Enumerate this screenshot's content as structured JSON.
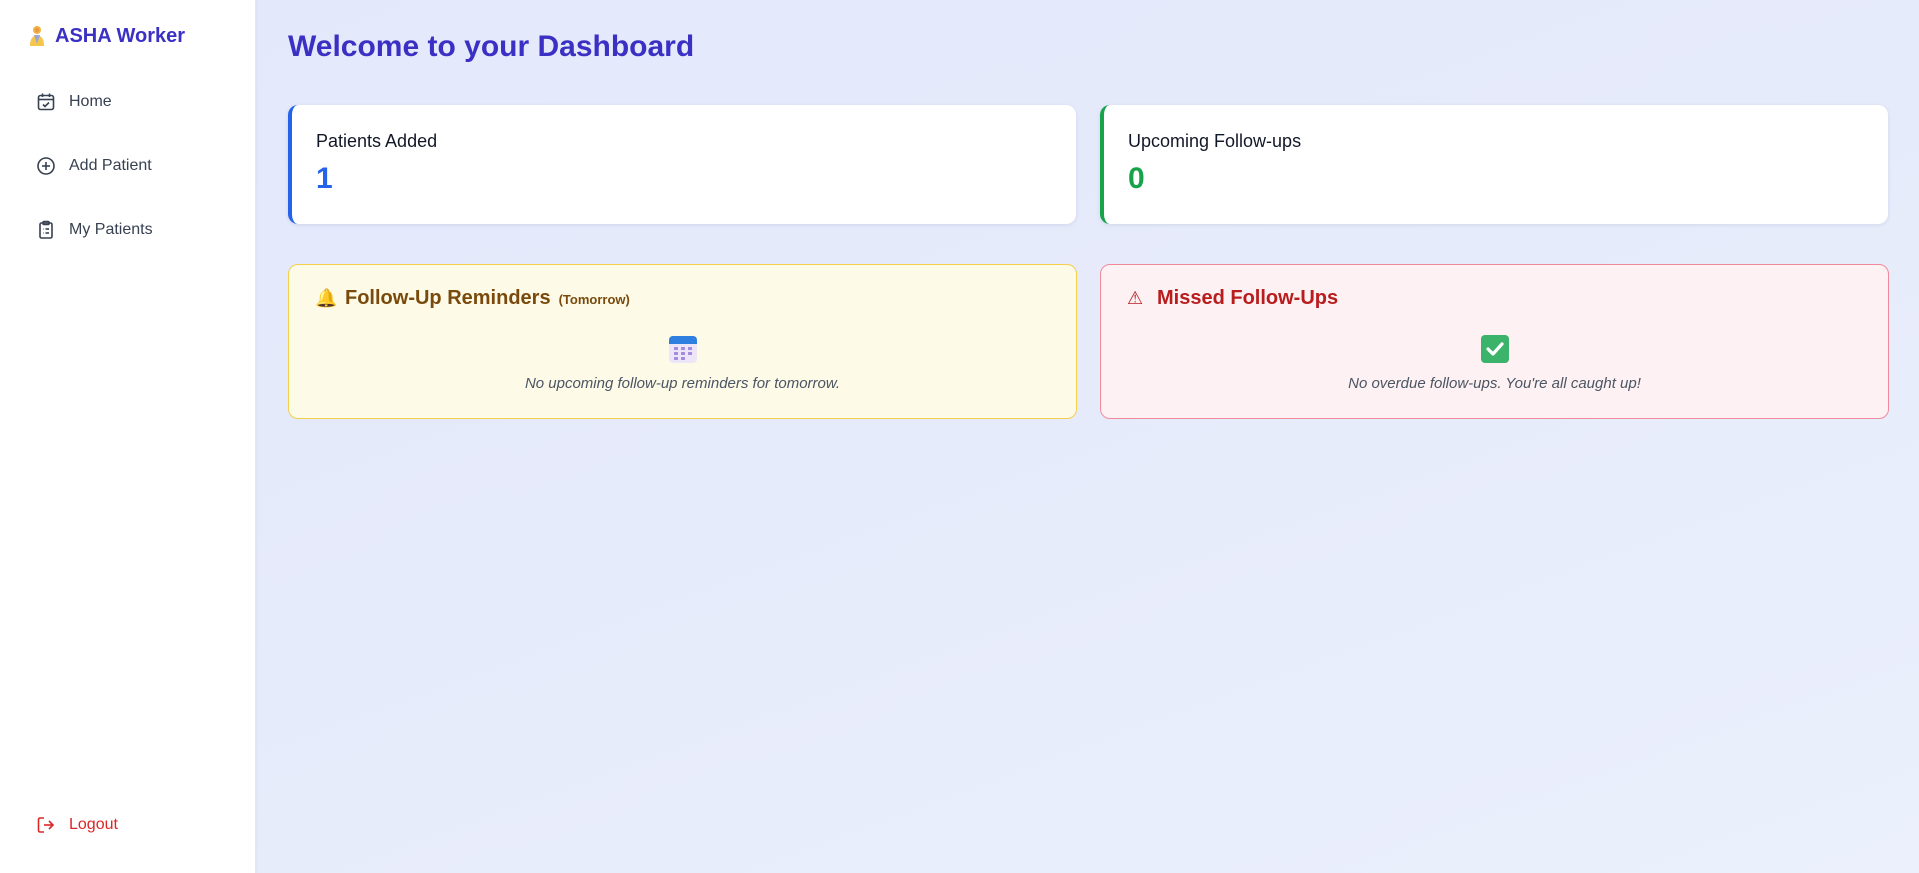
{
  "sidebar": {
    "brand": "ASHA Worker",
    "items": [
      {
        "label": "Home",
        "icon": "calendar-check-icon"
      },
      {
        "label": "Add Patient",
        "icon": "plus-circle-icon"
      },
      {
        "label": "My Patients",
        "icon": "clipboard-list-icon"
      }
    ],
    "logout": "Logout"
  },
  "main": {
    "title": "Welcome to your Dashboard",
    "stats": [
      {
        "label": "Patients Added",
        "value": "1",
        "color": "#2563eb"
      },
      {
        "label": "Upcoming Follow-ups",
        "value": "0",
        "color": "#16a34a"
      }
    ],
    "reminders": {
      "icon": "🔔",
      "title": "Follow-Up Reminders",
      "subtitle": "(Tomorrow)",
      "empty_text": "No upcoming follow-up reminders for tomorrow."
    },
    "missed": {
      "icon": "⚠",
      "title": "Missed Follow-Ups",
      "empty_text": "No overdue follow-ups. You're all caught up!"
    }
  },
  "colors": {
    "brand": "#3b30c4",
    "logout": "#dc2626",
    "reminder_bg": "#fdfae8",
    "missed_bg": "#fdf1f3"
  }
}
